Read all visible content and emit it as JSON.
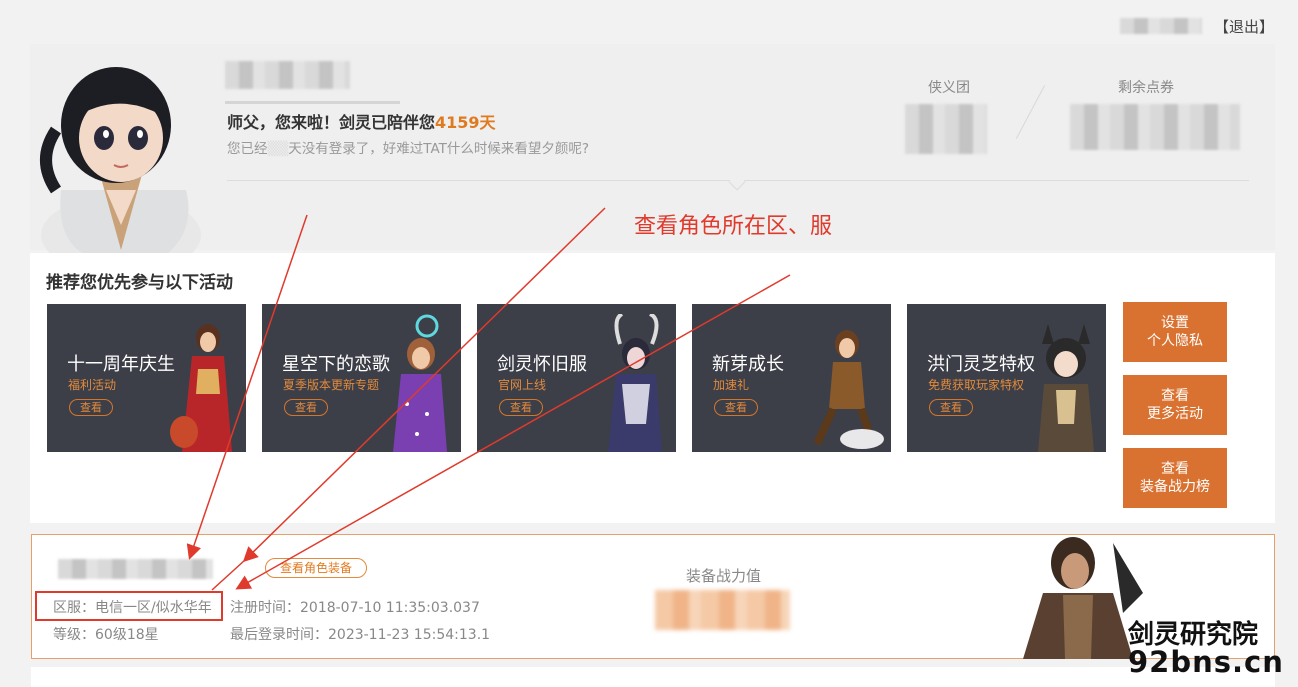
{
  "header": {
    "logout_label": "【退出】"
  },
  "profile": {
    "greeting_prefix": "师父，您来啦！剑灵已陪伴您",
    "days": "4159天",
    "subtext_a": "您已经",
    "subtext_b": "天没有登录了，好难过TAT什么时候来看望夕颜呢?",
    "stat1_label": "侠义团",
    "stat2_label": "剩余点券"
  },
  "annotation": "查看角色所在区、服",
  "activities": {
    "title": "推荐您优先参与以下活动",
    "cards": [
      {
        "title": "十一周年庆生",
        "subtitle": "福利活动",
        "button": "查看"
      },
      {
        "title": "星空下的恋歌",
        "subtitle": "夏季版本更新专题",
        "button": "查看"
      },
      {
        "title": "剑灵怀旧服",
        "subtitle": "官网上线",
        "button": "查看"
      },
      {
        "title": "新芽成长",
        "subtitle": "加速礼",
        "button": "查看"
      },
      {
        "title": "洪门灵芝特权",
        "subtitle": "免费获取玩家特权",
        "button": "查看"
      }
    ],
    "side_buttons": [
      {
        "line1": "设置",
        "line2": "个人隐私"
      },
      {
        "line1": "查看",
        "line2": "更多活动"
      },
      {
        "line1": "查看",
        "line2": "装备战力榜"
      }
    ]
  },
  "character": {
    "equip_link": "查看角色装备",
    "server_label": "区服：",
    "server_value": "电信一区/似水华年",
    "level_label": "等级：",
    "level_value": "60级18星",
    "reg_label": "注册时间：",
    "reg_value": "2018-07-10 11:35:03.037",
    "last_label": "最后登录时间：",
    "last_value": "2023-11-23 15:54:13.1",
    "power_label": "装备战力值"
  },
  "watermark": {
    "line1": "剑灵研究院",
    "line2": "92bns.cn"
  },
  "colors": {
    "accent": "#e07a1f",
    "button": "#d97230",
    "annotation": "#e03a2c",
    "card_bg": "#3c3f48"
  }
}
